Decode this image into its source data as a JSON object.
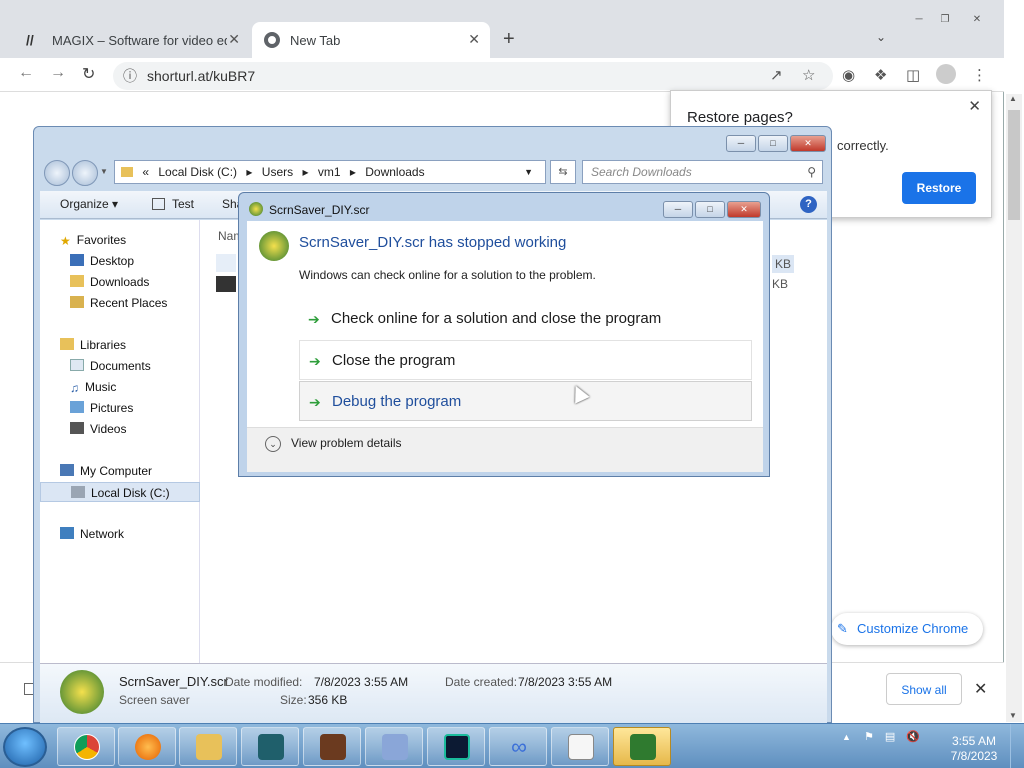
{
  "chrome": {
    "tabs": [
      {
        "title": "MAGIX – Software for video editi",
        "close": "✕"
      },
      {
        "title": "New Tab",
        "close": "✕"
      }
    ],
    "new_tab_glyph": "+",
    "url": "shorturl.at/kuBR7",
    "restore_popup": {
      "title": "Restore pages?",
      "message": "correctly.",
      "button": "Restore",
      "close": "✕"
    },
    "customize_label": "Customize Chrome",
    "downloads_bar": {
      "show_all": "Show all",
      "close": "✕"
    }
  },
  "explorer": {
    "breadcrumb": [
      "«",
      "Local Disk (C:)",
      "▸",
      "Users",
      "▸",
      "vm1",
      "▸",
      "Downloads"
    ],
    "search_placeholder": "Search Downloads",
    "toolbar": {
      "organize": "Organize ▾",
      "test": "Test",
      "share": "Sha"
    },
    "column_name": "Nam",
    "size_fragments": [
      "KB",
      "KB"
    ],
    "nav": {
      "favorites": "Favorites",
      "desktop": "Desktop",
      "downloads": "Downloads",
      "recent": "Recent Places",
      "libraries": "Libraries",
      "documents": "Documents",
      "music": "Music",
      "pictures": "Pictures",
      "videos": "Videos",
      "computer": "My Computer",
      "local_disk": "Local Disk (C:)",
      "network": "Network"
    },
    "details": {
      "name": "ScrnSaver_DIY.scr",
      "type": "Screen saver",
      "modified_label": "Date modified:",
      "modified": "7/8/2023 3:55 AM",
      "created_label": "Date created:",
      "created": "7/8/2023 3:55 AM",
      "size_label": "Size:",
      "size": "356 KB"
    }
  },
  "dialog": {
    "title": "ScrnSaver_DIY.scr",
    "heading": "ScrnSaver_DIY.scr has stopped working",
    "subtext": "Windows can check online for a solution to the problem.",
    "options": [
      "Check online for a solution and close the program",
      "Close the program",
      "Debug the program"
    ],
    "details_toggle": "View problem details"
  },
  "taskbar": {
    "time": "3:55 AM",
    "date": "7/8/2023",
    "tray_arrow": "▲"
  },
  "colors": {
    "accent": "#1a73e8",
    "taskbar": "#6a98c6",
    "dialog_link": "#1f4e9c"
  }
}
